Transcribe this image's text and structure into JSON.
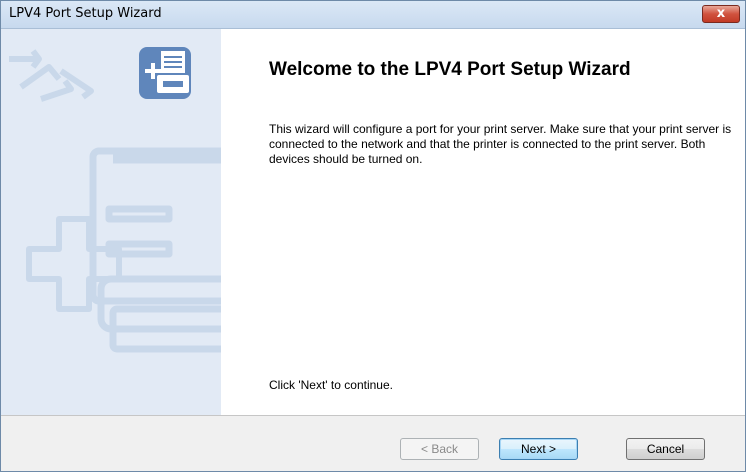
{
  "window": {
    "title": "LPV4 Port Setup Wizard",
    "close_glyph": "x"
  },
  "content": {
    "heading": "Welcome to the LPV4 Port Setup Wizard",
    "description": "This wizard will configure a port for your print server. Make sure that your print server is connected to the network and that the printer is connected to the print server. Both devices should be turned on.",
    "hint": "Click 'Next' to continue."
  },
  "buttons": {
    "back": "< Back",
    "next": "Next >",
    "cancel": "Cancel"
  },
  "icons": {
    "close": "close-icon",
    "network": "network-arrows-icon",
    "printer_badge": "add-printer-icon",
    "watermark": "printer-watermark-icon"
  },
  "colors": {
    "side_panel": "#e2eaf5",
    "badge": "#5f86bb",
    "watermark": "#c9d8ea",
    "footer": "#f0f0f0",
    "close": "#c23a26"
  }
}
